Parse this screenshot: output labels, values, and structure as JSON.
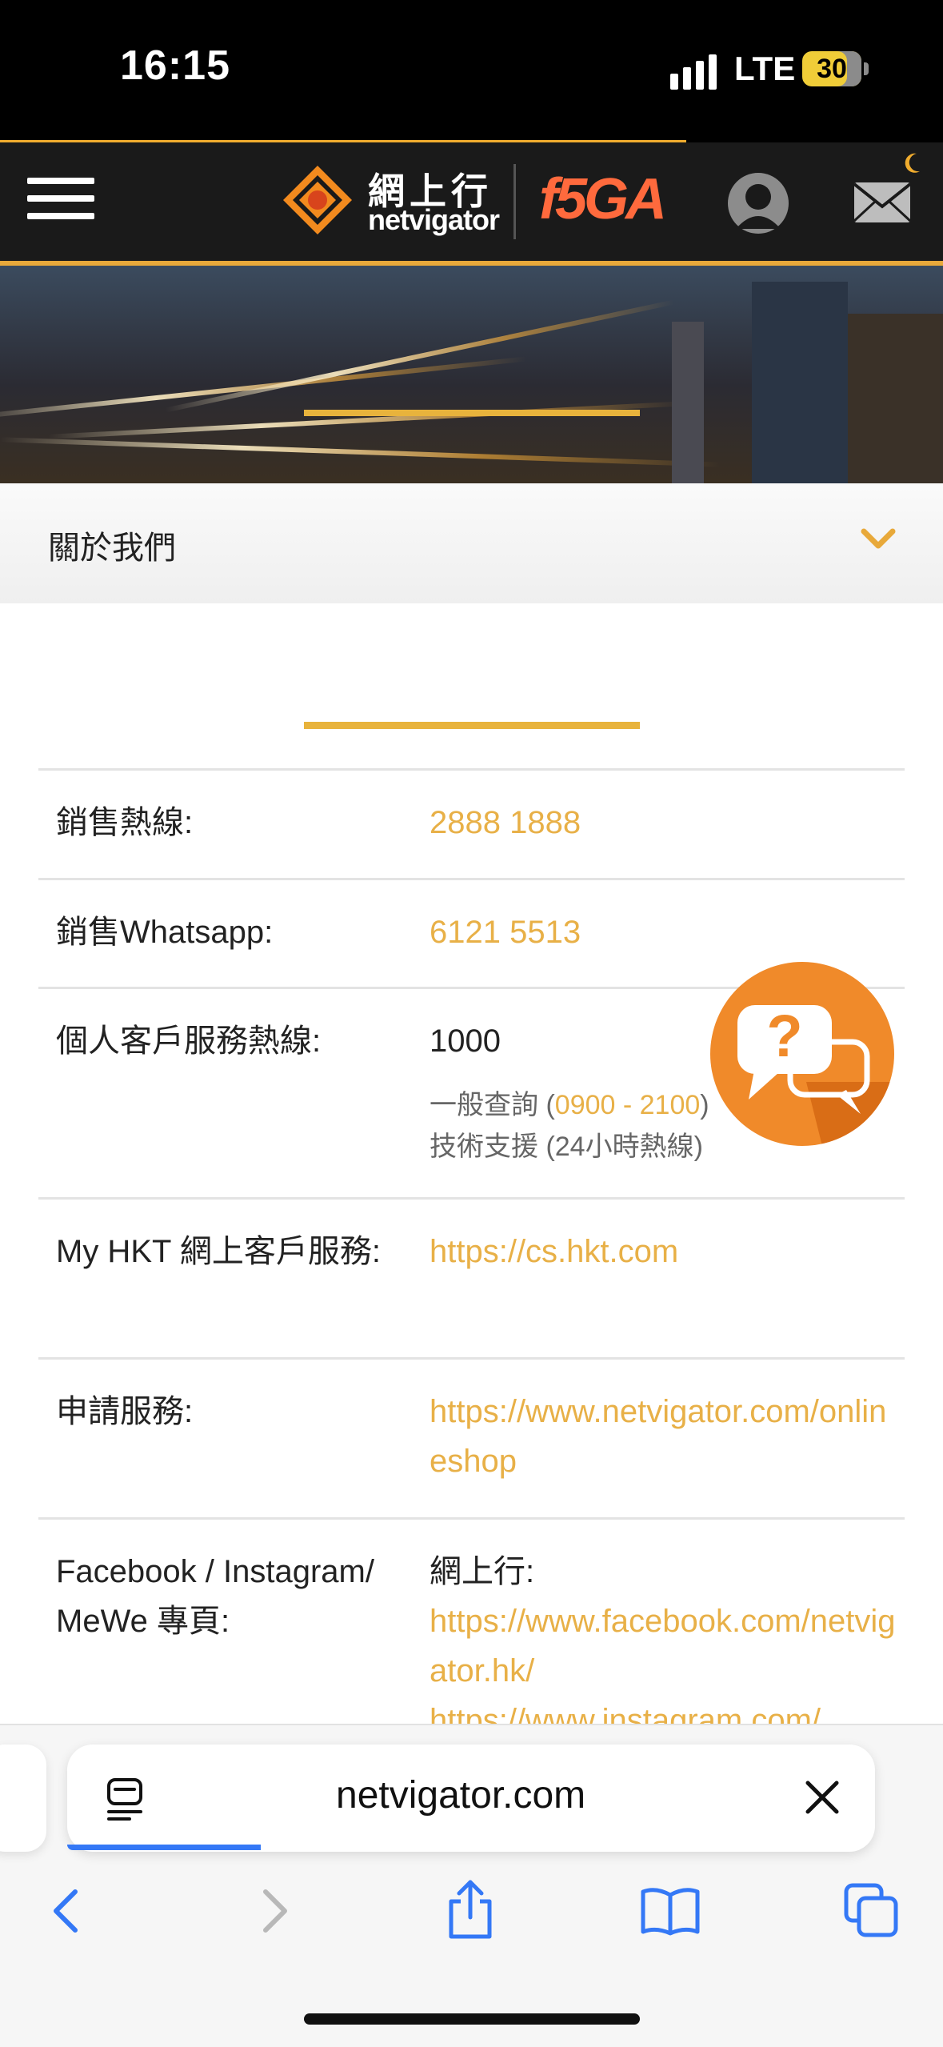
{
  "status_bar": {
    "time": "16:15",
    "network": "LTE",
    "battery": "30"
  },
  "header": {
    "logo_cn": "網上行",
    "logo_en": "netvigator",
    "brand_5g": "f5GA",
    "menu_icon": "hamburger-menu-icon",
    "account_icon": "user-avatar-icon",
    "mail_icon": "mail-icon"
  },
  "accordion": {
    "title": "關於我們",
    "icon": "chevron-down-icon"
  },
  "contacts": [
    {
      "label": "銷售熱線:",
      "value": "2888 1888"
    },
    {
      "label": "銷售Whatsapp:",
      "value": "6121 5513"
    },
    {
      "label": "個人客戶服務熱線:",
      "value": "1000",
      "sub1_prefix": "一般查詢 (",
      "sub1_hours": "0900 - 2100",
      "sub1_suffix": ")",
      "sub2": "技術支援 (24小時熱線)"
    },
    {
      "label": "My HKT 網上客戶服務:",
      "value": "https://cs.hkt.com"
    },
    {
      "label": "申請服務:",
      "value": "https://www.netvigator.com/onlineshop"
    },
    {
      "label": "Facebook / Instagram/ MeWe 專頁:",
      "value_title": "網上行:",
      "value": "https://www.facebook.com/netvigator.hk/",
      "value2": "https://www.instagram.com/"
    }
  ],
  "chat_widget": {
    "icon": "help-chat-icon"
  },
  "browser": {
    "url": "netvigator.com",
    "load_progress": 0.24
  },
  "toolbar": {
    "icons": [
      "back-icon",
      "forward-icon",
      "share-icon",
      "bookmarks-icon",
      "tabs-icon"
    ]
  },
  "colors": {
    "accent": "#e8b047",
    "header_bg": "#1a1a1a",
    "link_blue": "#3478f6"
  }
}
